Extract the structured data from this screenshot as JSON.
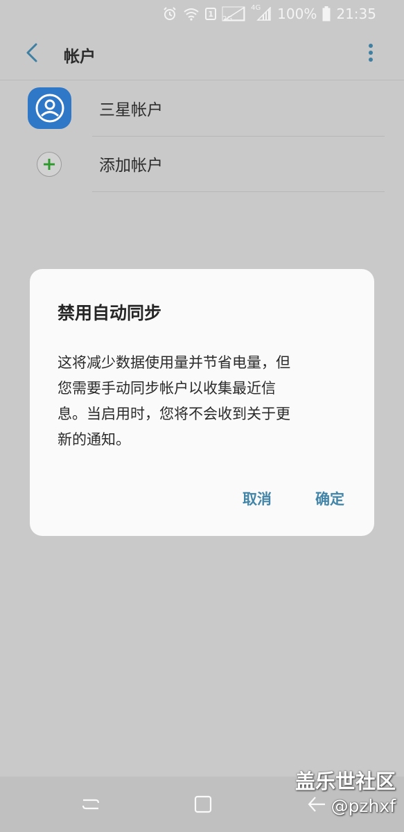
{
  "status_bar": {
    "sim_badge": "1",
    "network_2g": "2G",
    "network_4g": "4G",
    "battery_percent": "100%",
    "time": "21:35",
    "icons": [
      "alarm-icon",
      "wifi-icon",
      "sim-badge",
      "signal-2g-icon",
      "signal-4g-icon",
      "battery-icon"
    ]
  },
  "header": {
    "title": "帐户",
    "back_icon": "chevron-left-icon",
    "more_icon": "more-vert-icon"
  },
  "accounts": [
    {
      "label": "三星帐户",
      "icon": "person-circle-icon"
    },
    {
      "label": "添加帐户",
      "icon": "plus-icon"
    }
  ],
  "dialog": {
    "title": "禁用自动同步",
    "message_lines": [
      "这将减少数据使用量并节省电量，但",
      "您需要手动同步帐户以收集最近信",
      "息。当启用时，您将不会收到关于更",
      "新的通知。"
    ],
    "cancel_label": "取消",
    "ok_label": "确定"
  },
  "nav_bar": {
    "icons": [
      "recents-icon",
      "home-icon",
      "back-icon"
    ]
  },
  "watermark": {
    "title": "盖乐世社区",
    "handle": "@pzhxf"
  },
  "colors": {
    "accent": "#4285a8",
    "samsung_icon": "#2f78c8",
    "add_plus": "#2e9a2e",
    "scrim_background": "#c9c9c9"
  }
}
